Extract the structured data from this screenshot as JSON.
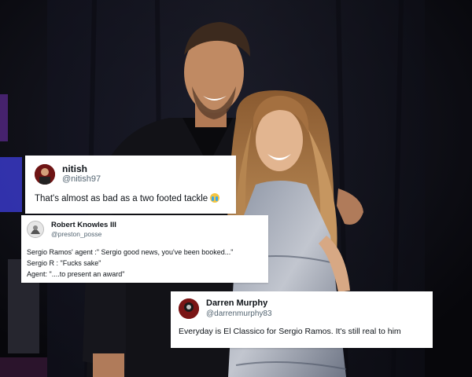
{
  "image": {
    "description_colors": {
      "background": "#0b0b12",
      "suit": "#15151a",
      "hair": "#b07a45",
      "dress": "#9aa3b3"
    }
  },
  "tweets": [
    {
      "name": "nitish",
      "handle": "@nitish97",
      "lines": [
        "That's almost as bad as a two footed tackle"
      ],
      "emoji": "crying-face-icon"
    },
    {
      "name": "Robert Knowles III",
      "handle": "@preston_posse",
      "lines": [
        "Sergio Ramos' agent :\" Sergio good news, you've been booked...\"",
        "Sergio R : \"Fucks sake\"",
        "Agent: \"....to present an award\""
      ]
    },
    {
      "name": "Darren Murphy",
      "handle": "@darrenmurphy83",
      "lines": [
        "Everyday is El Classico for Sergio Ramos. It's still real to him"
      ]
    }
  ]
}
